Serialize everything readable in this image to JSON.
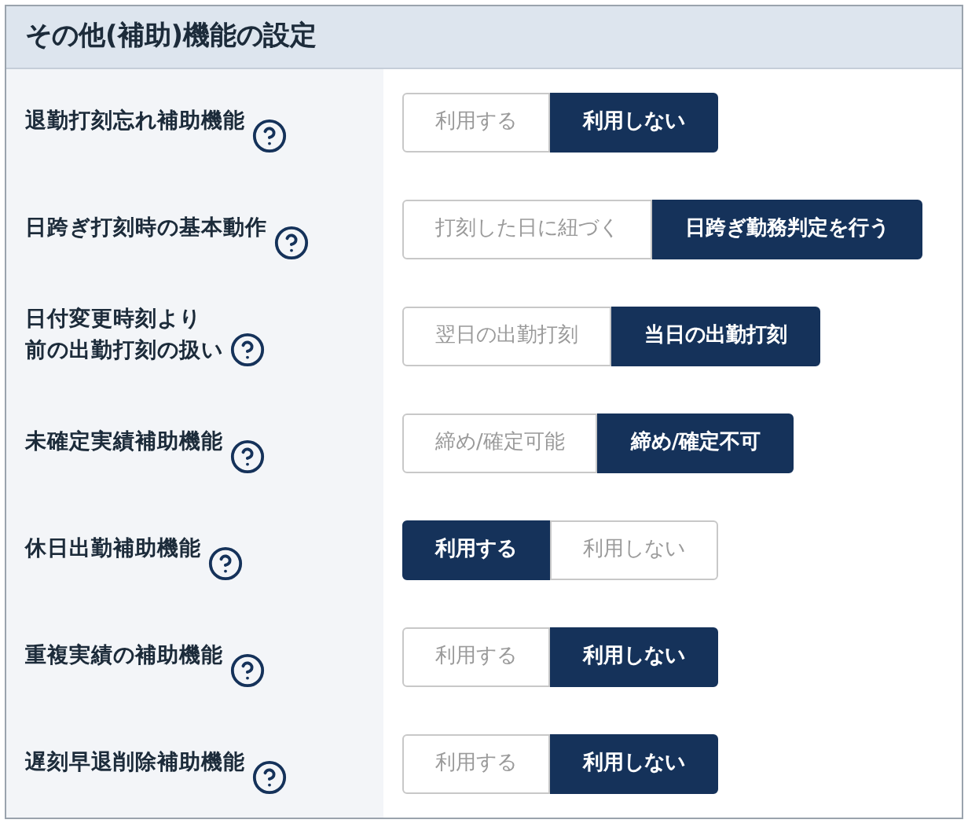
{
  "title": "その他(補助)機能の設定",
  "settings": [
    {
      "label": "退勤打刻忘れ補助機能",
      "options": [
        {
          "label": "利用する",
          "selected": false
        },
        {
          "label": "利用しない",
          "selected": true
        }
      ]
    },
    {
      "label": "日跨ぎ打刻時の基本動作",
      "options": [
        {
          "label": "打刻した日に紐づく",
          "selected": false
        },
        {
          "label": "日跨ぎ勤務判定を行う",
          "selected": true
        }
      ]
    },
    {
      "label_lines": [
        "日付変更時刻より",
        "前の出勤打刻の扱い"
      ],
      "options": [
        {
          "label": "翌日の出勤打刻",
          "selected": false
        },
        {
          "label": "当日の出勤打刻",
          "selected": true
        }
      ]
    },
    {
      "label": "未確定実績補助機能",
      "options": [
        {
          "label": "締め/確定可能",
          "selected": false
        },
        {
          "label": "締め/確定不可",
          "selected": true
        }
      ]
    },
    {
      "label": "休日出勤補助機能",
      "options": [
        {
          "label": "利用する",
          "selected": true
        },
        {
          "label": "利用しない",
          "selected": false
        }
      ]
    },
    {
      "label": "重複実績の補助機能",
      "options": [
        {
          "label": "利用する",
          "selected": false
        },
        {
          "label": "利用しない",
          "selected": true
        }
      ]
    },
    {
      "label": "遅刻早退削除補助機能",
      "options": [
        {
          "label": "利用する",
          "selected": false
        },
        {
          "label": "利用しない",
          "selected": true
        }
      ]
    }
  ]
}
